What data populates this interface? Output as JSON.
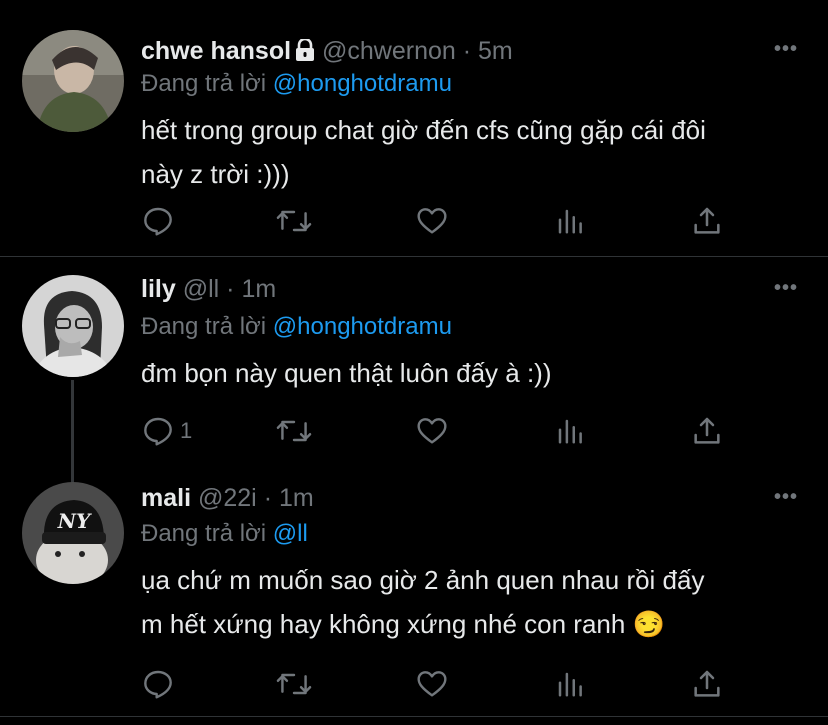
{
  "tweets": [
    {
      "name": "chwe hansol",
      "handle": "@chwernon",
      "sep": "·",
      "time": "5m",
      "reply_prefix": "Đang trả lời",
      "reply_to": "@honghotdramu",
      "text_lines": [
        "hết trong group chat giờ đến cfs cũng gặp cái đôi",
        "này z trời :)))"
      ],
      "reply_count": "",
      "protected": true
    },
    {
      "name": "lily",
      "handle": "@ll",
      "sep": "·",
      "time": "1m",
      "reply_prefix": "Đang trả lời",
      "reply_to": "@honghotdramu",
      "text_lines": [
        "đm bọn này quen thật luôn đấy à :))"
      ],
      "reply_count": "1",
      "protected": false
    },
    {
      "name": "mali",
      "handle": "@22i",
      "sep": "·",
      "time": "1m",
      "reply_prefix": "Đang trả lời",
      "reply_to": "@ll",
      "text_lines": [
        "ụa chứ m muốn sao giờ 2 ảnh quen nhau rồi đấy",
        "m hết xứng hay không xứng nhé con ranh 😏"
      ],
      "reply_count": "",
      "protected": false
    }
  ],
  "more_label": "•••",
  "colors": {
    "background": "#000000",
    "text": "#e7e9ea",
    "secondary": "#71767b",
    "accent": "#1d9bf0"
  },
  "icons": [
    "reply-icon",
    "retweet-icon",
    "like-icon",
    "analytics-icon",
    "share-icon",
    "lock-icon"
  ]
}
